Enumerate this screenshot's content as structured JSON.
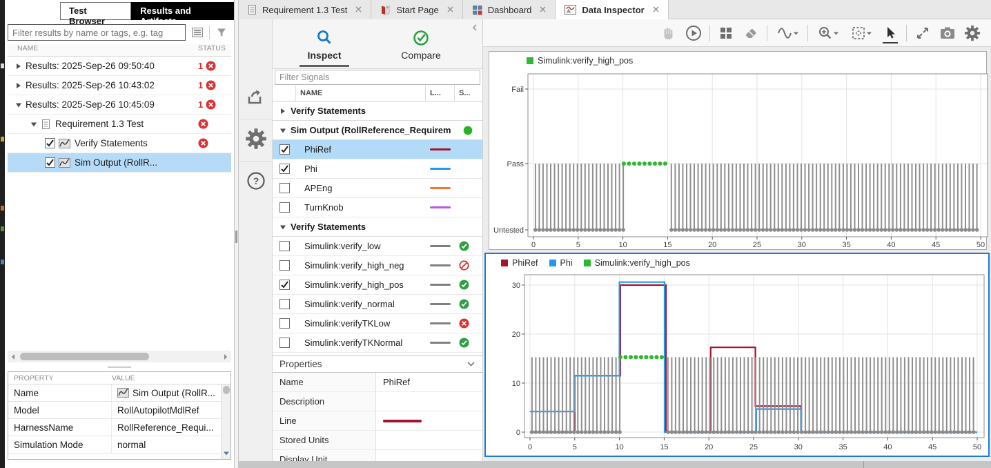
{
  "colors": {
    "accent_blue": "#1e7ad4",
    "selection_blue": "#b3dbf8",
    "status_fail_red": "#db3232",
    "status_pass_green": "#2ea043",
    "run_green": "#23b523",
    "verify_green": "#2db82d",
    "phiRef_maroon": "#A2142F",
    "phi_blue": "#1E9BF0",
    "apeng_orange": "#F87333",
    "turnknob_purple": "#BF53E3",
    "verify_gray": "#808080"
  },
  "left_panel": {
    "tabs": [
      {
        "label": "Test Browser",
        "active": false
      },
      {
        "label": "Results and Artifacts",
        "active": true
      }
    ],
    "filter_placeholder": "Filter results by name or tags, e.g. tag",
    "columns": {
      "name": "NAME",
      "status": "STATUS"
    },
    "tree": [
      {
        "label": "Results: 2025-Sep-26 09:50:40",
        "level": 0,
        "expander": "collapsed",
        "status_count": "1",
        "status": "fail"
      },
      {
        "label": "Results: 2025-Sep-26 10:43:02",
        "level": 0,
        "expander": "collapsed",
        "status_count": "1",
        "status": "fail"
      },
      {
        "label": "Results: 2025-Sep-26 10:45:09",
        "level": 0,
        "expander": "expanded",
        "status_count": "1",
        "status": "fail"
      },
      {
        "label": "Requirement 1.3 Test",
        "level": 1,
        "expander": "expanded",
        "icon": "document",
        "status": "fail"
      },
      {
        "label": "Verify Statements",
        "level": 2,
        "checkbox": true,
        "checked": true,
        "icon": "signal",
        "status": "fail"
      },
      {
        "label": "Sim Output (RollR...",
        "level": 2,
        "checkbox": true,
        "checked": true,
        "icon": "signal",
        "selected": true
      }
    ],
    "properties": {
      "columns": [
        "PROPERTY",
        "VALUE"
      ],
      "rows": [
        {
          "property": "Name",
          "value": "Sim Output (RollR...",
          "value_icon": "signal"
        },
        {
          "property": "Model",
          "value": "RollAutopilotMdlRef"
        },
        {
          "property": "HarnessName",
          "value": "RollReference_Requi..."
        },
        {
          "property": "Simulation Mode",
          "value": "normal"
        }
      ]
    }
  },
  "doc_tabs": [
    {
      "label": "Requirement 1.3 Test",
      "icon": "document-tab",
      "active": false
    },
    {
      "label": "Start Page",
      "icon": "book",
      "active": false
    },
    {
      "label": "Dashboard",
      "icon": "dashboard",
      "active": false
    },
    {
      "label": "Data Inspector",
      "icon": "plot",
      "active": true
    }
  ],
  "inspector": {
    "tabs": [
      {
        "label": "Inspect",
        "active": true
      },
      {
        "label": "Compare",
        "active": false
      }
    ],
    "filter_placeholder": "Filter Signals",
    "columns": [
      "NAME",
      "L...",
      "S..."
    ],
    "list": [
      {
        "kind": "group",
        "label": "Verify Statements",
        "expanded": false
      },
      {
        "kind": "group",
        "label": "Sim Output (RollReference_Requirem",
        "expanded": true,
        "run_indicator": true
      },
      {
        "kind": "signal",
        "label": "PhiRef",
        "checked": true,
        "line_color": "#A2142F",
        "selected": true
      },
      {
        "kind": "signal",
        "label": "Phi",
        "checked": true,
        "line_color": "#1E9BF0"
      },
      {
        "kind": "signal",
        "label": "APEng",
        "checked": false,
        "line_color": "#F87333"
      },
      {
        "kind": "signal",
        "label": "TurnKnob",
        "checked": false,
        "line_color": "#BF53E3"
      },
      {
        "kind": "group",
        "label": "Verify Statements",
        "expanded": true
      },
      {
        "kind": "signal",
        "label": "Simulink:verify_low",
        "checked": false,
        "line_color": "#808080",
        "status": "pass"
      },
      {
        "kind": "signal",
        "label": "Simulink:verify_high_neg",
        "checked": false,
        "line_color": "#808080",
        "status": "untested"
      },
      {
        "kind": "signal",
        "label": "Simulink:verify_high_pos",
        "checked": true,
        "line_color": "#808080",
        "status": "pass"
      },
      {
        "kind": "signal",
        "label": "Simulink:verify_normal",
        "checked": false,
        "line_color": "#808080",
        "status": "pass"
      },
      {
        "kind": "signal",
        "label": "Simulink:verifyTKLow",
        "checked": false,
        "line_color": "#808080",
        "status": "fail"
      },
      {
        "kind": "signal",
        "label": "Simulink:verifyTKNormal",
        "checked": false,
        "line_color": "#808080",
        "status": "pass"
      }
    ],
    "properties": {
      "header": "Properties",
      "rows": [
        {
          "label": "Name",
          "value": "PhiRef"
        },
        {
          "label": "Description",
          "value": ""
        },
        {
          "label": "Line",
          "value": "",
          "swatch": "#A2142F"
        },
        {
          "label": "Stored Units",
          "value": ""
        },
        {
          "label": "Display Unit",
          "value": "",
          "partial": true
        }
      ]
    }
  },
  "charts_toolbar": [
    {
      "icon": "hand",
      "disabled": true
    },
    {
      "icon": "play"
    },
    {
      "sep": true
    },
    {
      "icon": "layout-grid"
    },
    {
      "icon": "eraser"
    },
    {
      "sep": true
    },
    {
      "icon": "signal-wave",
      "caret": true
    },
    {
      "sep": true
    },
    {
      "icon": "zoom-in",
      "caret": true
    },
    {
      "icon": "fit-view",
      "caret": true
    },
    {
      "icon": "cursor",
      "active": true
    },
    {
      "sep": true
    },
    {
      "icon": "expand"
    },
    {
      "icon": "camera"
    },
    {
      "icon": "gear"
    }
  ],
  "chart_data": [
    {
      "type": "step",
      "subplot": "verify-status",
      "legend": [
        {
          "label": "Simulink:verify_high_pos",
          "color": "#2DB82D"
        }
      ],
      "x": {
        "min": 0,
        "max": 50,
        "tick_step": 5,
        "ticks": [
          0,
          5,
          10,
          15,
          20,
          25,
          30,
          35,
          40,
          45,
          50
        ]
      },
      "y": {
        "type": "categorical",
        "labels": [
          "Fail",
          "Pass",
          "Untested"
        ]
      },
      "verify": {
        "untested_spans": [
          [
            0,
            10.1
          ],
          [
            15.2,
            50
          ]
        ],
        "pass_spans": [
          [
            10.1,
            15.15
          ]
        ]
      },
      "grid": true,
      "legend_position": "top-left"
    },
    {
      "type": "step",
      "subplot": "signals",
      "selected": true,
      "legend": [
        {
          "label": "PhiRef",
          "color": "#A2142F"
        },
        {
          "label": "Phi",
          "color": "#1E9BF0"
        },
        {
          "label": "Simulink:verify_high_pos",
          "color": "#2DB82D"
        }
      ],
      "x": {
        "min": 0,
        "max": 50,
        "tick_step": 5,
        "ticks": [
          0,
          5,
          10,
          15,
          20,
          25,
          30,
          35,
          40,
          45,
          50
        ]
      },
      "y": {
        "type": "numeric",
        "ticks": [
          0,
          10,
          20,
          30
        ],
        "lim": [
          -2,
          33
        ]
      },
      "series": [
        {
          "name": "PhiRef",
          "color": "#A2142F",
          "points": [
            [
              0,
              0
            ],
            [
              5,
              0
            ],
            [
              5,
              11.5
            ],
            [
              10.1,
              11.5
            ],
            [
              10.1,
              30
            ],
            [
              15.2,
              30
            ],
            [
              15.2,
              0
            ],
            [
              20.2,
              0
            ],
            [
              20.2,
              17.3
            ],
            [
              25.2,
              17.3
            ],
            [
              25.2,
              5.3
            ],
            [
              30.3,
              5.3
            ],
            [
              30.3,
              0
            ],
            [
              50,
              0
            ]
          ]
        },
        {
          "name": "Phi",
          "color": "#1E9BF0",
          "points": [
            [
              0,
              4.2
            ],
            [
              5,
              4.2
            ],
            [
              5,
              11.5
            ],
            [
              10,
              11.5
            ],
            [
              10,
              30.6
            ],
            [
              15.05,
              30.6
            ],
            [
              15.05,
              0
            ],
            [
              25.3,
              0
            ],
            [
              25.3,
              4.7
            ],
            [
              30.3,
              4.7
            ],
            [
              30.3,
              0
            ],
            [
              50,
              0
            ]
          ]
        }
      ],
      "verify": {
        "level": 15.3,
        "untested_spans": [
          [
            0,
            10.1
          ],
          [
            15.2,
            50
          ]
        ],
        "pass_spans": [
          [
            10.1,
            15.15
          ]
        ]
      },
      "grid": true,
      "legend_position": "top-left"
    }
  ]
}
